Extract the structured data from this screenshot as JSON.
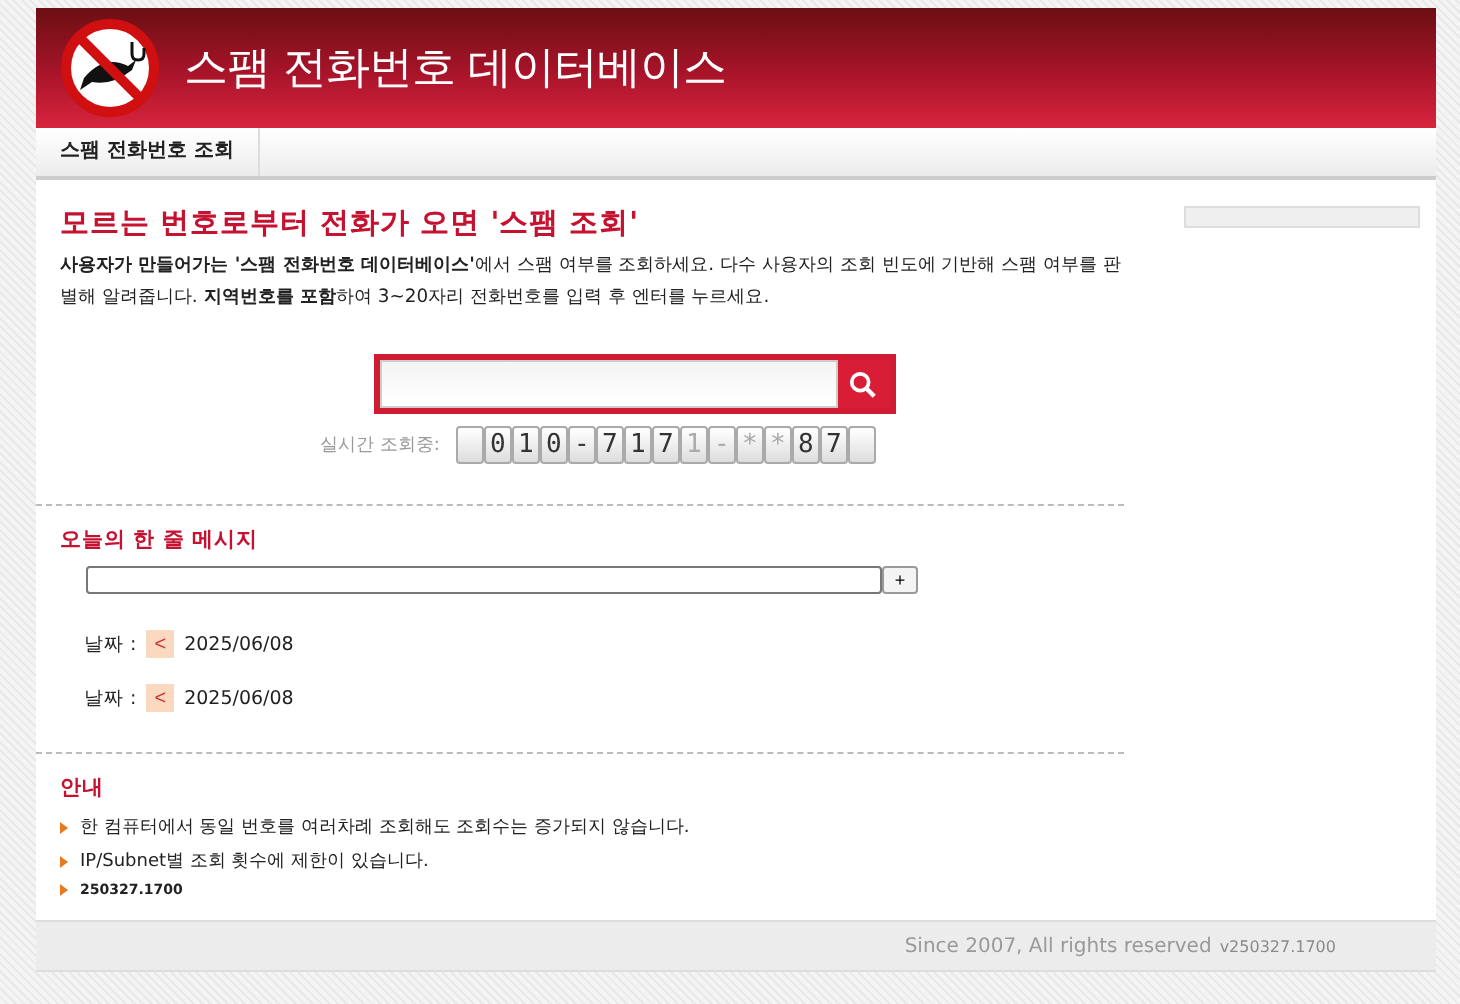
{
  "header": {
    "title": "스팸 전화번호 데이터베이스"
  },
  "nav": [
    {
      "label": "스팸 전화번호 조회"
    }
  ],
  "intro": {
    "heading": "모르는 번호로부터 전화가 오면 '스팸 조회'",
    "text": "**사용자가 만들어가는 '스팸 전화번호 데이터베이스'**에서 스팸 여부를 조회하세요. 다수 사용자의 조회 빈도에 기반해 스팸 여부를 판별해 알려줍니다. **지역번호를 포함**하여 3~20자리 전화번호를 입력 후 엔터를 누르세요."
  },
  "ticker": {
    "label": "실시간 조회중:",
    "chars": [
      {
        "ch": "0",
        "dim": false
      },
      {
        "ch": "1",
        "dim": false
      },
      {
        "ch": "0",
        "dim": false
      },
      {
        "ch": "-",
        "dim": false
      },
      {
        "ch": "7",
        "dim": false
      },
      {
        "ch": "1",
        "dim": false
      },
      {
        "ch": "7",
        "dim": false
      },
      {
        "ch": "1",
        "dim": true
      },
      {
        "ch": "-",
        "dim": true
      },
      {
        "ch": "*",
        "dim": true
      },
      {
        "ch": "*",
        "dim": true
      },
      {
        "ch": "8",
        "dim": false
      },
      {
        "ch": "7",
        "dim": false
      }
    ]
  },
  "message": {
    "heading": "오늘의 한 줄 메시지",
    "add": "+",
    "dates": [
      {
        "label": "날짜 :",
        "prev": "<",
        "date": "2025/06/08"
      },
      {
        "label": "날짜 :",
        "prev": "<",
        "date": "2025/06/08"
      }
    ]
  },
  "notes": {
    "heading": "안내",
    "items": [
      {
        "text": "한 컴퓨터에서 동일 번호를 여러차례 조회해도 조회수는 증가되지 않습니다.",
        "kind": "normal"
      },
      {
        "text": "IP/Subnet별 조회 횟수에 제한이 있습니다.",
        "kind": "normal"
      },
      {
        "text": "250327.1700",
        "kind": "small"
      }
    ]
  },
  "footer": {
    "text": "Since 2007, All rights reserved",
    "version": "v250327.1700"
  }
}
